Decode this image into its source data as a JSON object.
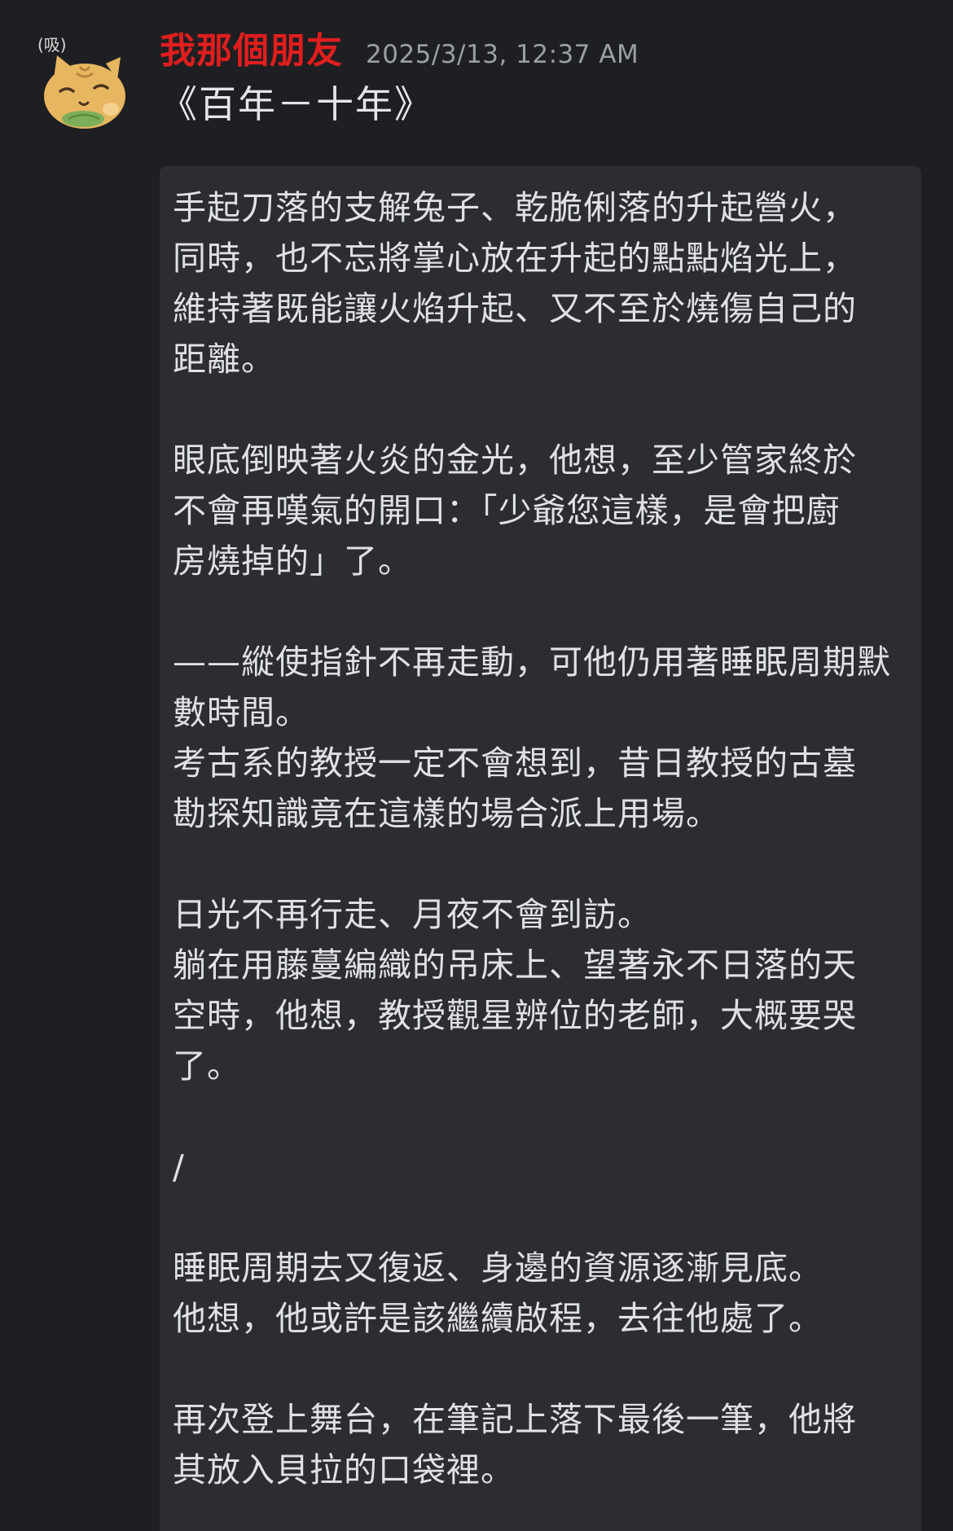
{
  "message": {
    "author": "我那個朋友",
    "timestamp": "2025/3/13, 12:37 AM",
    "avatar": {
      "icon": "cat-avatar-icon",
      "badge_text": "(吸)"
    },
    "title": "《百年－十年》",
    "quote_lines": [
      "手起刀落的支解兔子、乾脆俐落的升起營火，",
      "同時，也不忘將掌心放在升起的點點焰光上，",
      "維持著既能讓火焰升起、又不至於燒傷自己的",
      "距離。",
      "",
      "眼底倒映著火炎的金光，他想，至少管家終於",
      "不會再嘆氣的開口：「少爺您這樣，是會把廚",
      "房燒掉的」了。",
      "",
      "——縱使指針不再走動，可他仍用著睡眠周期默",
      "數時間。",
      "考古系的教授一定不會想到，昔日教授的古墓",
      "勘探知識竟在這樣的場合派上用場。",
      "",
      "日光不再行走、月夜不會到訪。",
      "躺在用藤蔓編織的吊床上、望著永不日落的天",
      "空時，他想，教授觀星辨位的老師，大概要哭",
      "了。",
      "",
      "/",
      "",
      "睡眠周期去又復返、身邊的資源逐漸見底。",
      "他想，他或許是該繼續啟程，去往他處了。",
      "",
      "再次登上舞台，在筆記上落下最後一筆，他將",
      "其放入貝拉的口袋裡。"
    ]
  },
  "colors": {
    "background": "#1e1f22",
    "quote_background": "#2b2d31",
    "username": "#e01e1e",
    "timestamp": "#9b9ea4",
    "text": "#dfe1e5"
  }
}
